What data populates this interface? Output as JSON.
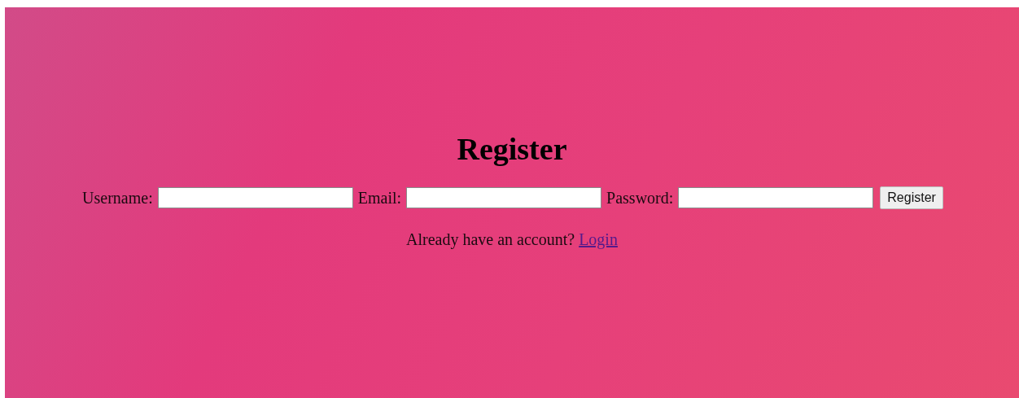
{
  "heading": "Register",
  "fields": [
    {
      "label": "Username:"
    },
    {
      "label": "Email:"
    },
    {
      "label": "Password:"
    }
  ],
  "submit_button": "Register",
  "footer": {
    "text": "Already have an account?",
    "link": "Login"
  }
}
